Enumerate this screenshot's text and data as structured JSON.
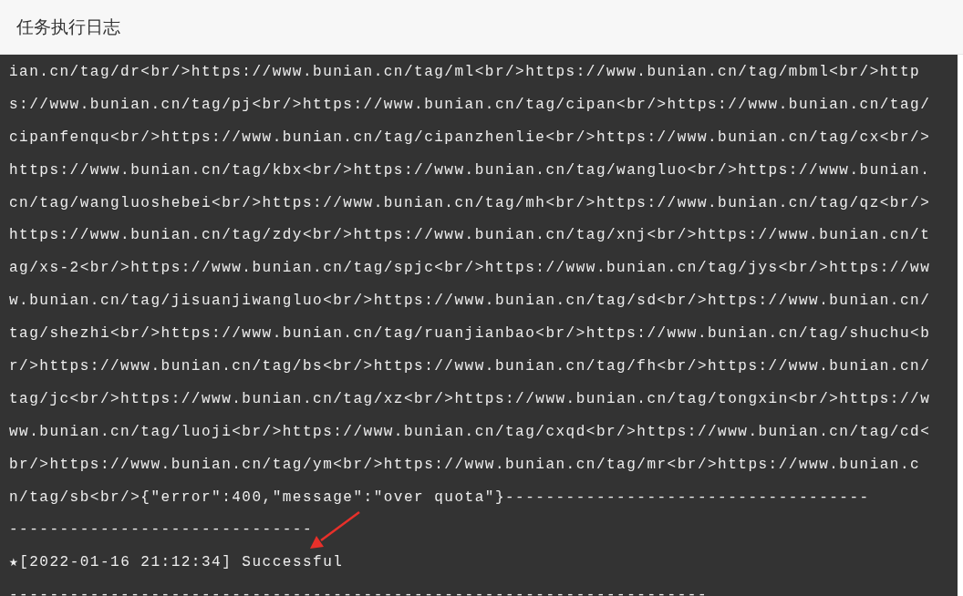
{
  "header": {
    "title": "任务执行日志"
  },
  "log": {
    "lines": [
      "ian.cn/tag/dr<br/>https://www.bunian.cn/tag/ml<br/>https://www.bunian.cn/tag/mbml<br/>http",
      "s://www.bunian.cn/tag/pj<br/>https://www.bunian.cn/tag/cipan<br/>https://www.bunian.cn/tag/",
      "cipanfenqu<br/>https://www.bunian.cn/tag/cipanzhenlie<br/>https://www.bunian.cn/tag/cx<br/>",
      "https://www.bunian.cn/tag/kbx<br/>https://www.bunian.cn/tag/wangluo<br/>https://www.bunian.",
      "cn/tag/wangluoshebei<br/>https://www.bunian.cn/tag/mh<br/>https://www.bunian.cn/tag/qz<br/>",
      "https://www.bunian.cn/tag/zdy<br/>https://www.bunian.cn/tag/xnj<br/>https://www.bunian.cn/t",
      "ag/xs-2<br/>https://www.bunian.cn/tag/spjc<br/>https://www.bunian.cn/tag/jys<br/>https://ww",
      "w.bunian.cn/tag/jisuanjiwangluo<br/>https://www.bunian.cn/tag/sd<br/>https://www.bunian.cn/",
      "tag/shezhi<br/>https://www.bunian.cn/tag/ruanjianbao<br/>https://www.bunian.cn/tag/shuchu<b",
      "r/>https://www.bunian.cn/tag/bs<br/>https://www.bunian.cn/tag/fh<br/>https://www.bunian.cn/",
      "tag/jc<br/>https://www.bunian.cn/tag/xz<br/>https://www.bunian.cn/tag/tongxin<br/>https://w",
      "ww.bunian.cn/tag/luoji<br/>https://www.bunian.cn/tag/cxqd<br/>https://www.bunian.cn/tag/cd<",
      "br/>https://www.bunian.cn/tag/ym<br/>https://www.bunian.cn/tag/mr<br/>https://www.bunian.c",
      "n/tag/sb<br/>{\"error\":400,\"message\":\"over quota\"}------------------------------------",
      "------------------------------",
      "★[2022-01-16 21:12:34] Successful",
      "---------------------------------------------------------------------"
    ]
  }
}
